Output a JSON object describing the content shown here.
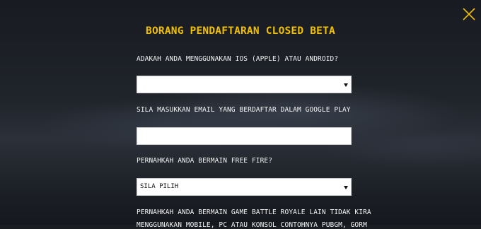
{
  "form": {
    "title": "BORANG PENDAFTARAN CLOSED BETA",
    "q1_label": "ADAKAH ANDA MENGGUNAKAN IOS (APPLE) ATAU ANDROID?",
    "q1_value": "",
    "q2_label": "SILA MASUKKAN EMAIL YANG BERDAFTAR DALAM GOOGLE PLAY",
    "q2_value": "",
    "q3_label": "PERNAHKAH ANDA BERMAIN FREE FIRE?",
    "q3_value": "SILA PILIH",
    "q4_label_line1": "PERNAHKAH ANDA BERMAIN GAME BATTLE ROYALE LAIN TIDAK KIRA",
    "q4_label_line2": "MENGGUNAKAN MOBILE, PC ATAU KONSOL CONTOHNYA PUBGM, GORM"
  },
  "icons": {
    "close": "close-icon",
    "dropdown": "chevron-down-icon"
  },
  "colors": {
    "accent": "#f0c000",
    "background": "#1a1d22",
    "text": "#f4f4f4"
  }
}
